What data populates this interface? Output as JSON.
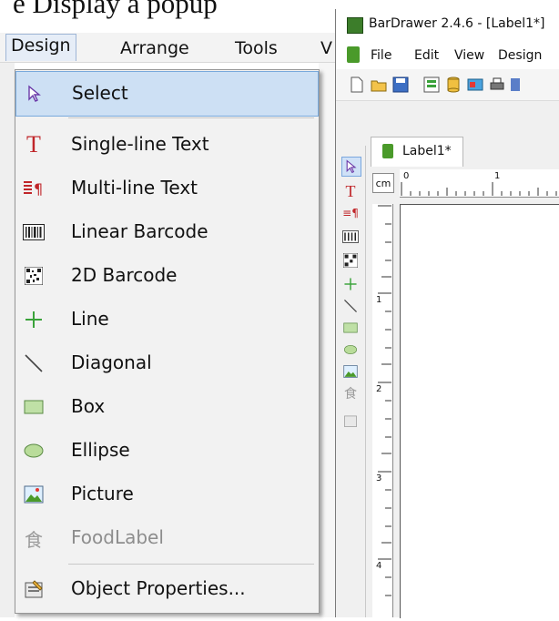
{
  "doc_fragment": "e Display a popup",
  "bg_menubar": {
    "items": [
      "Design",
      "Arrange",
      "Tools"
    ]
  },
  "dropdown": {
    "items": [
      {
        "label": "Select",
        "icon": "arrow-pointer-icon",
        "disabled": false
      },
      {
        "label": "Single-line Text",
        "icon": "text-t-icon",
        "disabled": false
      },
      {
        "label": "Multi-line Text",
        "icon": "multiline-text-icon",
        "disabled": false
      },
      {
        "label": "Linear Barcode",
        "icon": "linear-barcode-icon",
        "disabled": false
      },
      {
        "label": "2D Barcode",
        "icon": "qr-code-icon",
        "disabled": false
      },
      {
        "label": "Line",
        "icon": "line-plus-icon",
        "disabled": false
      },
      {
        "label": "Diagonal",
        "icon": "diagonal-line-icon",
        "disabled": false
      },
      {
        "label": "Box",
        "icon": "box-icon",
        "disabled": false
      },
      {
        "label": "Ellipse",
        "icon": "ellipse-icon",
        "disabled": false
      },
      {
        "label": "Picture",
        "icon": "picture-icon",
        "disabled": false
      },
      {
        "label": "FoodLabel",
        "icon": "foodlabel-icon",
        "disabled": true
      },
      {
        "label": "Object Properties...",
        "icon": "properties-icon",
        "disabled": false
      }
    ]
  },
  "app": {
    "title": "BarDrawer 2.4.6 - [Label1*]",
    "menu": [
      "File",
      "Edit",
      "View",
      "Design"
    ],
    "tab_label": "Label1*",
    "unit": "cm",
    "hruler_labels": [
      "0",
      "1"
    ],
    "vruler_labels": [
      "1",
      "2",
      "3",
      "4"
    ]
  },
  "colors": {
    "accent_select": "#cde0f4",
    "text_t_red": "#c0262a",
    "line_green": "#3aa23a"
  }
}
